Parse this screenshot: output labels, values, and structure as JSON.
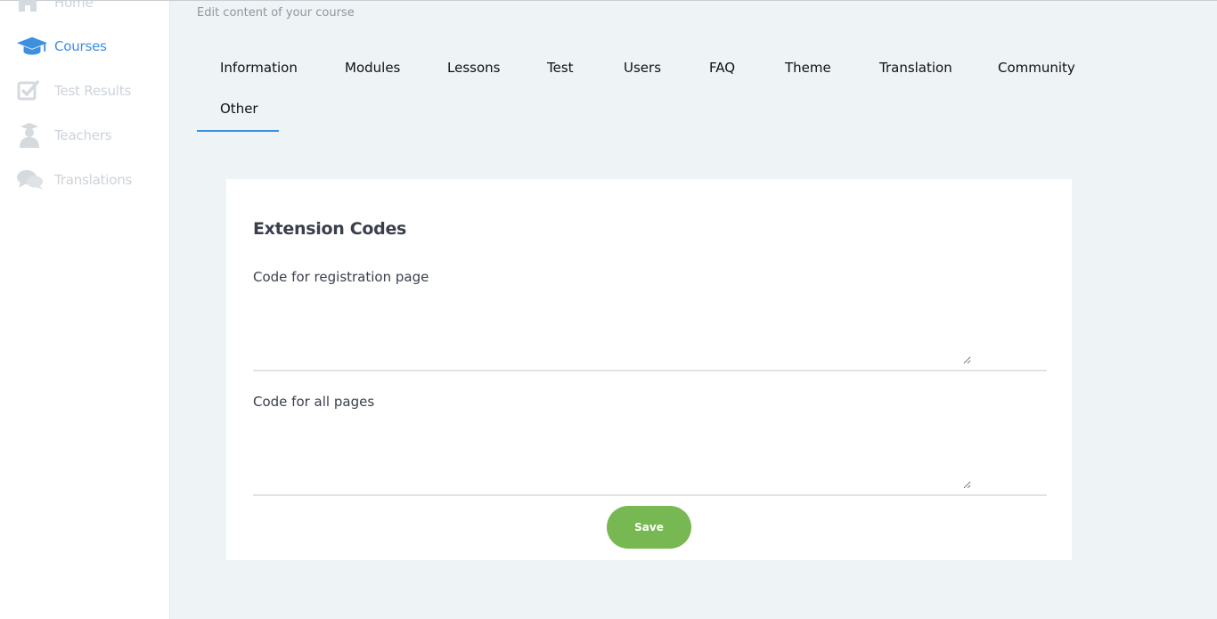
{
  "page": {
    "subtitle": "Edit content of your course"
  },
  "sidebar": {
    "items": [
      {
        "label": "Home",
        "icon": "home-icon",
        "active": false
      },
      {
        "label": "Courses",
        "icon": "graduation-cap-icon",
        "active": true
      },
      {
        "label": "Test Results",
        "icon": "checkbox-icon",
        "active": false
      },
      {
        "label": "Teachers",
        "icon": "teacher-icon",
        "active": false
      },
      {
        "label": "Translations",
        "icon": "chat-bubbles-icon",
        "active": false
      }
    ]
  },
  "tabs": [
    {
      "label": "Information"
    },
    {
      "label": "Modules"
    },
    {
      "label": "Lessons"
    },
    {
      "label": "Test"
    },
    {
      "label": "Users"
    },
    {
      "label": "FAQ"
    },
    {
      "label": "Theme"
    },
    {
      "label": "Translation"
    },
    {
      "label": "Community"
    },
    {
      "label": "Other",
      "active": true
    }
  ],
  "card": {
    "title": "Extension Codes",
    "fields": [
      {
        "label": "Code for registration page",
        "value": ""
      },
      {
        "label": "Code for all pages",
        "value": ""
      }
    ],
    "save_label": "Save"
  },
  "colors": {
    "accent": "#3d8fe0",
    "save": "#77b852",
    "background": "#eef3f6",
    "sidebar_inactive": "#cdd3d9"
  }
}
